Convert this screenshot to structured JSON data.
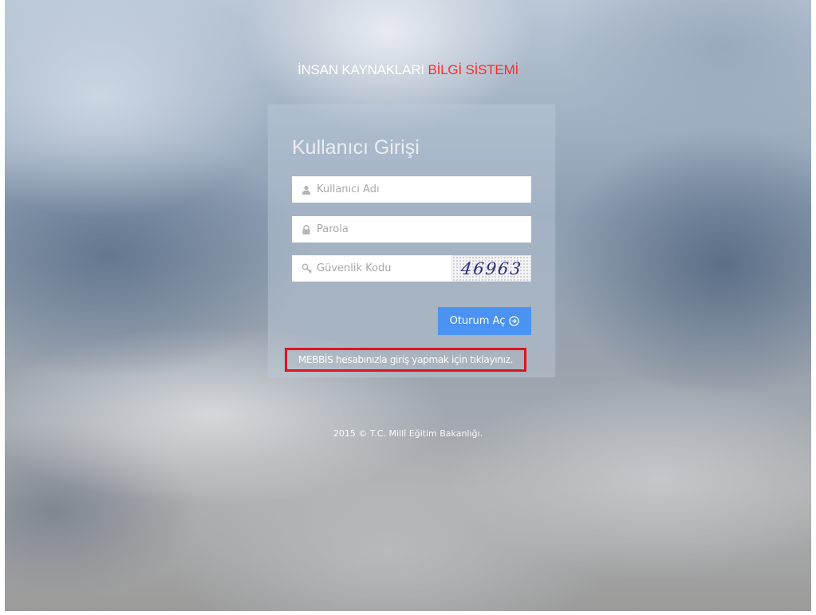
{
  "app_title": {
    "part1": "İNSAN KAYNAKLARI ",
    "part2": "BİLGİ SİSTEMİ"
  },
  "login_panel": {
    "title": "Kullanıcı Girişi",
    "username": {
      "placeholder": "Kullanıcı Adı",
      "value": "",
      "icon": "user-icon"
    },
    "password": {
      "placeholder": "Parola",
      "value": "",
      "icon": "lock-icon"
    },
    "security_code": {
      "placeholder": "Güvenlik Kodu",
      "value": "",
      "icon": "key-icon"
    },
    "captcha_text": "46963",
    "login_button": {
      "label": "Oturum Aç",
      "icon": "arrow-circle-right-icon"
    },
    "mebbis_link": "MEBBİS hesabınızla giriş yapmak için tıklayınız."
  },
  "footer": {
    "copyright": "2015 © T.C. Millî Eğitim Bakanlığı."
  },
  "colors": {
    "accent_red": "#ff2b2b",
    "button_blue": "#4a93f2",
    "highlight_border": "#e0141c"
  }
}
